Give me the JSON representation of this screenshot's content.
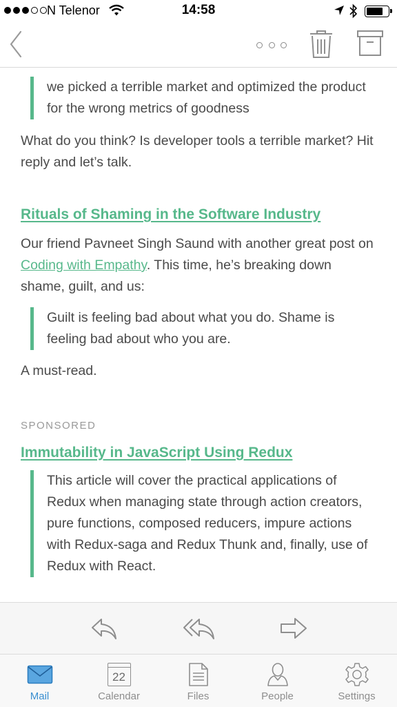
{
  "status_bar": {
    "carrier": "N Telenor",
    "time": "14:58"
  },
  "nav": {
    "icons": [
      "back-chevron-icon",
      "more-icon",
      "trash-icon",
      "archive-icon"
    ]
  },
  "content": {
    "quote1": "we picked a terrible market and optimized the product for the wrong metrics of goodness",
    "para1": "What do you think? Is developer tools a terrible market? Hit reply and let’s talk.",
    "section1": {
      "heading": "Rituals of Shaming in the Software Industry",
      "intro_prefix": "Our friend Pavneet Singh Saund with another great post on ",
      "intro_link": "Coding with Empathy",
      "intro_suffix": ". This time, he’s breaking down shame, guilt, and us:",
      "quote": "Guilt is feeling bad about what you do. Shame is feeling bad about who you are.",
      "outro": "A must-read."
    },
    "sponsored_label": "SPONSORED",
    "section2": {
      "heading": "Immutability in JavaScript Using Redux",
      "quote": "This article will cover the practical applications of Redux when managing state through action creators, pure functions, composed reducers, impure actions with Redux-saga and Redux Thunk and, finally, use of Redux with React."
    }
  },
  "action_bar": {
    "icons": [
      "reply-icon",
      "reply-all-icon",
      "forward-icon"
    ]
  },
  "tab_bar": {
    "tabs": [
      {
        "label": "Mail",
        "icon": "mail-icon",
        "active": true
      },
      {
        "label": "Calendar",
        "icon": "calendar-icon",
        "day": "22"
      },
      {
        "label": "Files",
        "icon": "files-icon"
      },
      {
        "label": "People",
        "icon": "people-icon"
      },
      {
        "label": "Settings",
        "icon": "settings-icon"
      }
    ]
  },
  "colors": {
    "accent_green": "#57b88b",
    "accent_blue": "#3a8fd0",
    "icon_gray": "#8e8e8e"
  }
}
